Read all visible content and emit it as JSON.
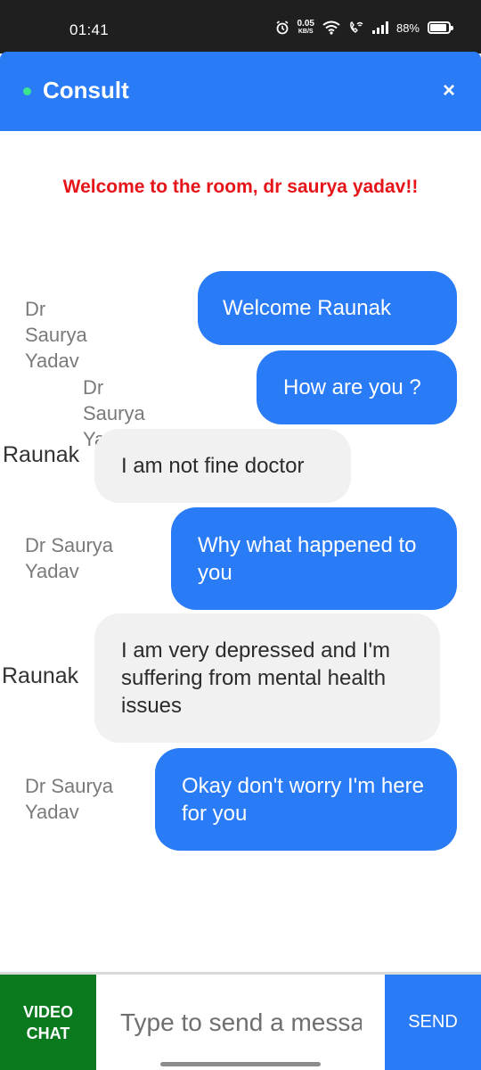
{
  "status_bar": {
    "time": "01:41",
    "net_speed_value": "0.05",
    "net_speed_unit": "KB/S",
    "battery_percent": "88%",
    "battery_level": 0.88
  },
  "header": {
    "title": "Consult",
    "close_label": "×",
    "accent_color": "#2a7bf6",
    "online_color": "#3ee58f"
  },
  "welcome_text": "Welcome to the room, dr saurya yadav!!",
  "messages": [
    {
      "sender": "Dr Saurya Yadav",
      "text": "Welcome Raunak",
      "direction": "outgoing"
    },
    {
      "sender": "Dr Saurya Yadav",
      "text": "How are you ?",
      "direction": "outgoing"
    },
    {
      "sender": "Raunak",
      "text": "I am not fine doctor",
      "direction": "incoming"
    },
    {
      "sender": "Dr Saurya Yadav",
      "text": "Why what happened to you",
      "direction": "outgoing"
    },
    {
      "sender": "Raunak",
      "text": "I am very depressed and I'm suffering from mental health issues",
      "direction": "incoming"
    },
    {
      "sender": "Dr Saurya Yadav",
      "text": "Okay don't worry I'm here for you",
      "direction": "outgoing"
    }
  ],
  "composer": {
    "video_chat_label": "VIDEO CHAT",
    "input_placeholder": "Type to send a message",
    "send_label": "SEND"
  }
}
